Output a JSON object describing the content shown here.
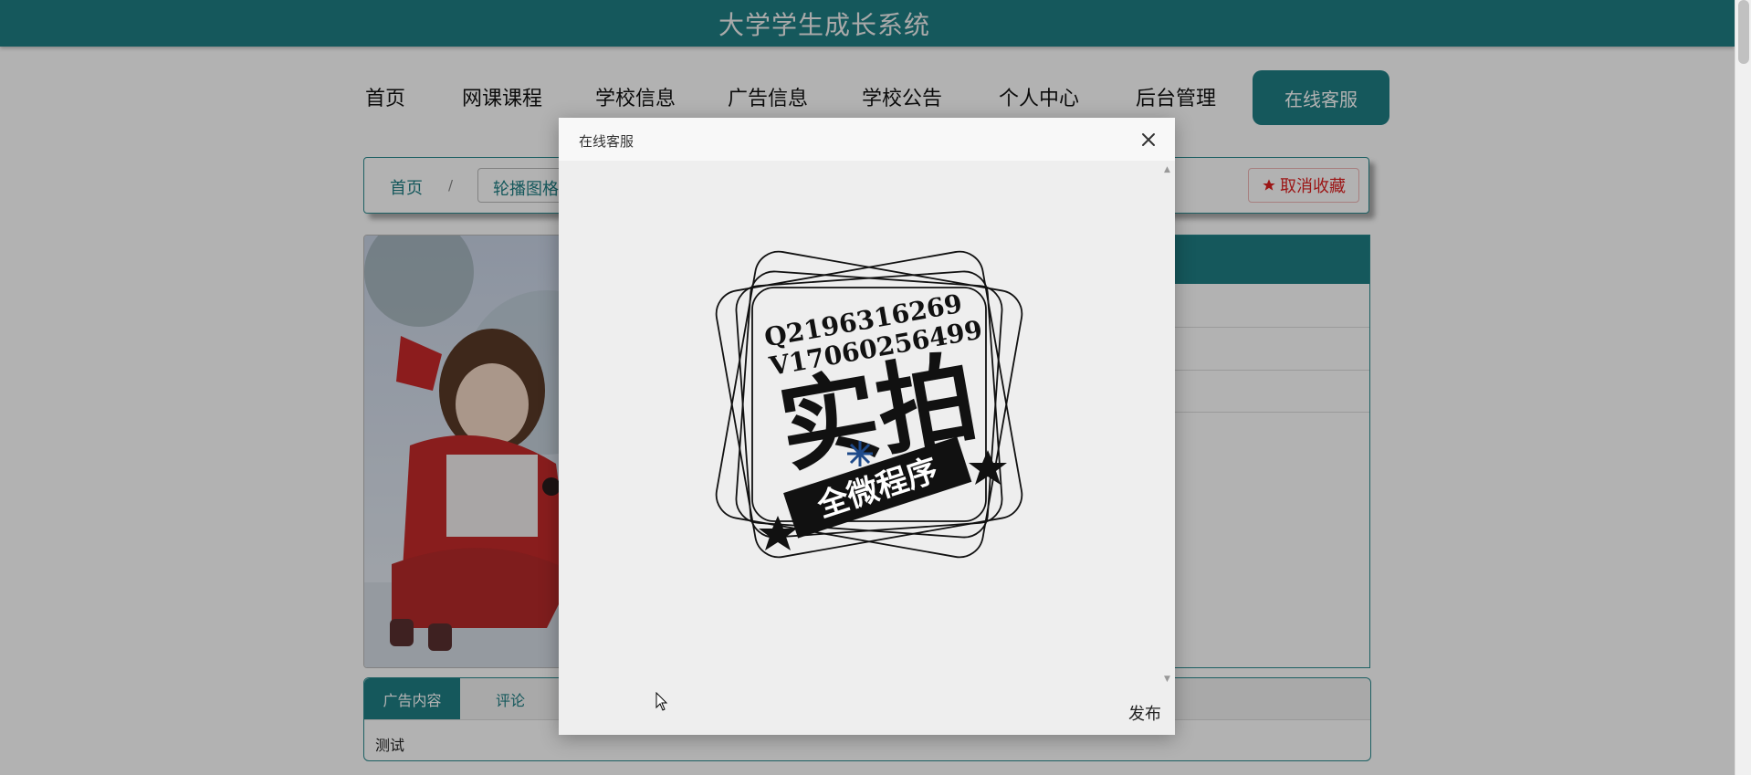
{
  "header": {
    "title": "大学学生成长系统"
  },
  "nav": {
    "items": [
      "首页",
      "网课课程",
      "学校信息",
      "广告信息",
      "学校公告",
      "个人中心",
      "后台管理"
    ],
    "service_label": "在线客服"
  },
  "breadcrumb": {
    "home": "首页",
    "separator": "/",
    "current": "轮播图格"
  },
  "favorite": {
    "label": "取消收藏"
  },
  "tabs": {
    "items": [
      "广告内容",
      "评论"
    ],
    "content": "测试"
  },
  "modal": {
    "title": "在线客服",
    "publish_label": "发布",
    "stamp": {
      "line1": "Q2196316269",
      "line2": "V17060256499",
      "main": "实拍",
      "banner": "全微程序"
    }
  },
  "colors": {
    "brand": "#1f7f85",
    "favorite": "#e02020"
  }
}
